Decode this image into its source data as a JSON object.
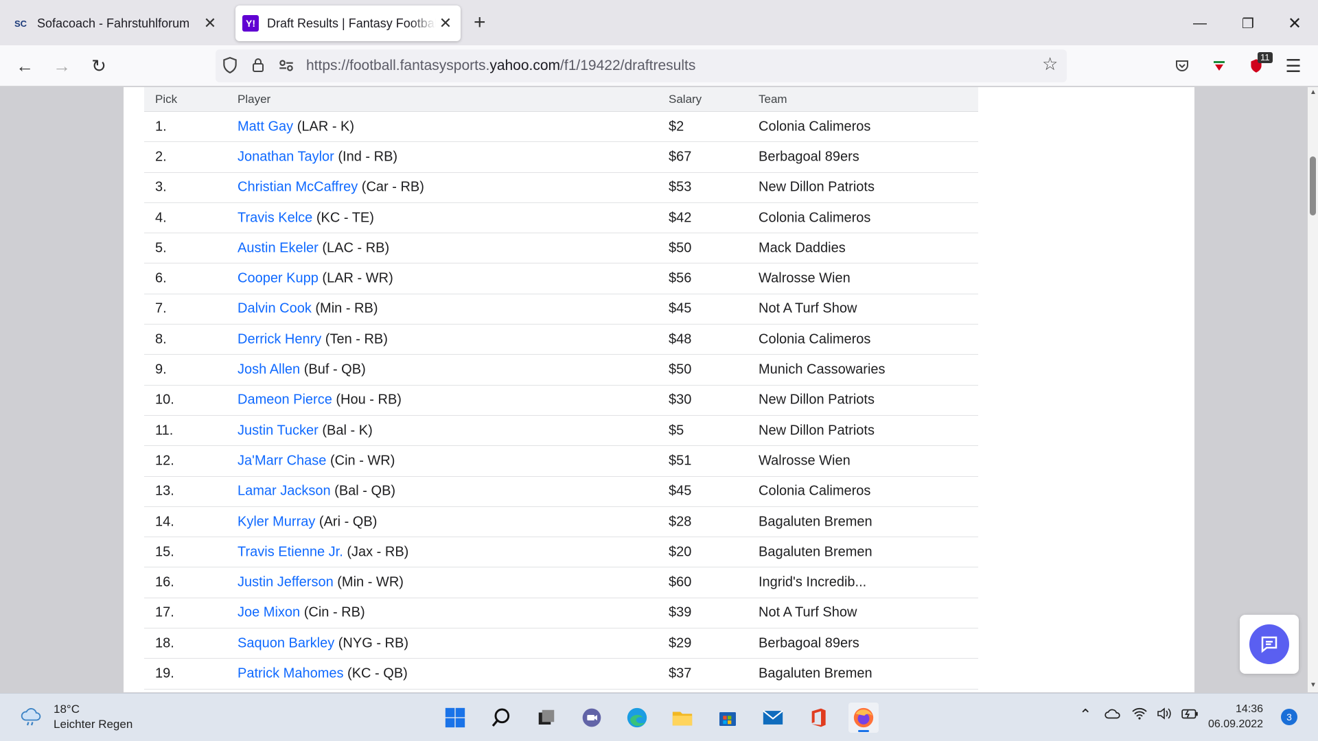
{
  "browser": {
    "tabs": [
      {
        "favicon": "SC",
        "title": "Sofacoach - Fahrstuhlforum",
        "close": "✕"
      },
      {
        "favicon": "Y!",
        "title": "Draft Results | Fantasy Football",
        "close": "✕"
      }
    ],
    "new_tab": "+",
    "url_prefix": "https://football.fantasysports.",
    "url_domain": "yahoo.com",
    "url_suffix": "/f1/19422/draftresults",
    "extension_badge": "11"
  },
  "table": {
    "headers": {
      "pick": "Pick",
      "player": "Player",
      "salary": "Salary",
      "team": "Team"
    },
    "rows": [
      {
        "pick": "1.",
        "name": "Matt Gay",
        "info": " (LAR - K)",
        "salary": "$2",
        "team": "Colonia Calimeros"
      },
      {
        "pick": "2.",
        "name": "Jonathan Taylor",
        "info": " (Ind - RB)",
        "salary": "$67",
        "team": "Berbagoal 89ers"
      },
      {
        "pick": "3.",
        "name": "Christian McCaffrey",
        "info": " (Car - RB)",
        "salary": "$53",
        "team": "New Dillon Patriots"
      },
      {
        "pick": "4.",
        "name": "Travis Kelce",
        "info": " (KC - TE)",
        "salary": "$42",
        "team": "Colonia Calimeros"
      },
      {
        "pick": "5.",
        "name": "Austin Ekeler",
        "info": " (LAC - RB)",
        "salary": "$50",
        "team": "Mack Daddies"
      },
      {
        "pick": "6.",
        "name": "Cooper Kupp",
        "info": " (LAR - WR)",
        "salary": "$56",
        "team": "Walrosse Wien"
      },
      {
        "pick": "7.",
        "name": "Dalvin Cook",
        "info": " (Min - RB)",
        "salary": "$45",
        "team": "Not A Turf Show"
      },
      {
        "pick": "8.",
        "name": "Derrick Henry",
        "info": " (Ten - RB)",
        "salary": "$48",
        "team": "Colonia Calimeros"
      },
      {
        "pick": "9.",
        "name": "Josh Allen",
        "info": " (Buf - QB)",
        "salary": "$50",
        "team": "Munich Cassowaries"
      },
      {
        "pick": "10.",
        "name": "Dameon Pierce",
        "info": " (Hou - RB)",
        "salary": "$30",
        "team": "New Dillon Patriots"
      },
      {
        "pick": "11.",
        "name": "Justin Tucker",
        "info": " (Bal - K)",
        "salary": "$5",
        "team": "New Dillon Patriots"
      },
      {
        "pick": "12.",
        "name": "Ja'Marr Chase",
        "info": " (Cin - WR)",
        "salary": "$51",
        "team": "Walrosse Wien"
      },
      {
        "pick": "13.",
        "name": "Lamar Jackson",
        "info": " (Bal - QB)",
        "salary": "$45",
        "team": "Colonia Calimeros"
      },
      {
        "pick": "14.",
        "name": "Kyler Murray",
        "info": " (Ari - QB)",
        "salary": "$28",
        "team": "Bagaluten Bremen"
      },
      {
        "pick": "15.",
        "name": "Travis Etienne Jr.",
        "info": " (Jax - RB)",
        "salary": "$20",
        "team": "Bagaluten Bremen"
      },
      {
        "pick": "16.",
        "name": "Justin Jefferson",
        "info": " (Min - WR)",
        "salary": "$60",
        "team": "Ingrid's Incredib..."
      },
      {
        "pick": "17.",
        "name": "Joe Mixon",
        "info": " (Cin - RB)",
        "salary": "$39",
        "team": "Not A Turf Show"
      },
      {
        "pick": "18.",
        "name": "Saquon Barkley",
        "info": " (NYG - RB)",
        "salary": "$29",
        "team": "Berbagoal 89ers"
      },
      {
        "pick": "19.",
        "name": "Patrick Mahomes",
        "info": " (KC - QB)",
        "salary": "$37",
        "team": "Bagaluten Bremen"
      }
    ]
  },
  "taskbar": {
    "temperature": "18°C",
    "weather": "Leichter Regen",
    "time": "14:36",
    "date": "06.09.2022",
    "notifications": "3"
  },
  "colors": {
    "link": "#0f69ff",
    "yahoo": "#6001d2",
    "chat": "#5a5ff1"
  }
}
